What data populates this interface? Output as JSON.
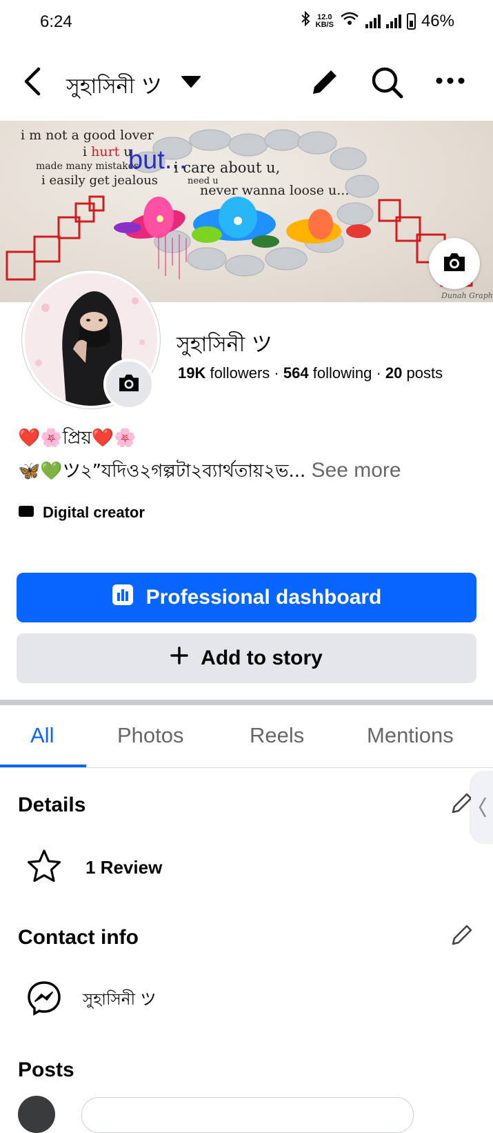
{
  "status_bar": {
    "time": "6:24",
    "net_speed": "12.0",
    "net_unit": "KB/S",
    "battery": "46%"
  },
  "header": {
    "title": "সুহাসিনী ツ"
  },
  "cover": {
    "line1": "i m not a good lover",
    "line2_a": "i",
    "line2_b": "hurt",
    "line2_c": "u",
    "line3": "made many mistakes",
    "line4": "i easily get jealous",
    "but": "but...",
    "care": "i care about u,",
    "need": "need u",
    "never": "never wanna loose u..."
  },
  "profile": {
    "name": "সুহাসিনী ツ",
    "followers_count": "19K",
    "followers_label": "followers",
    "following_count": "564",
    "following_label": "following",
    "posts_count": "20",
    "posts_label": "posts",
    "bio_line1": "❤️🌸প্রিয়❤️🌸",
    "bio_line2": "🦋💚ツ২”যদিও২গল্পটা২ব্যার্থতায়২ভ...",
    "see_more": "See more",
    "category": "Digital creator"
  },
  "actions": {
    "professional_dashboard": "Professional dashboard",
    "add_to_story": "Add to story"
  },
  "tabs": [
    {
      "label": "All"
    },
    {
      "label": "Photos"
    },
    {
      "label": "Reels"
    },
    {
      "label": "Mentions"
    }
  ],
  "details": {
    "title": "Details",
    "review": "1 Review"
  },
  "contact": {
    "title": "Contact info",
    "messenger": "সুহাসিনী ツ"
  },
  "posts": {
    "title": "Posts"
  },
  "colors": {
    "accent": "#0866ff",
    "secondary_button": "#e4e6eb",
    "muted_text": "#65676b"
  }
}
